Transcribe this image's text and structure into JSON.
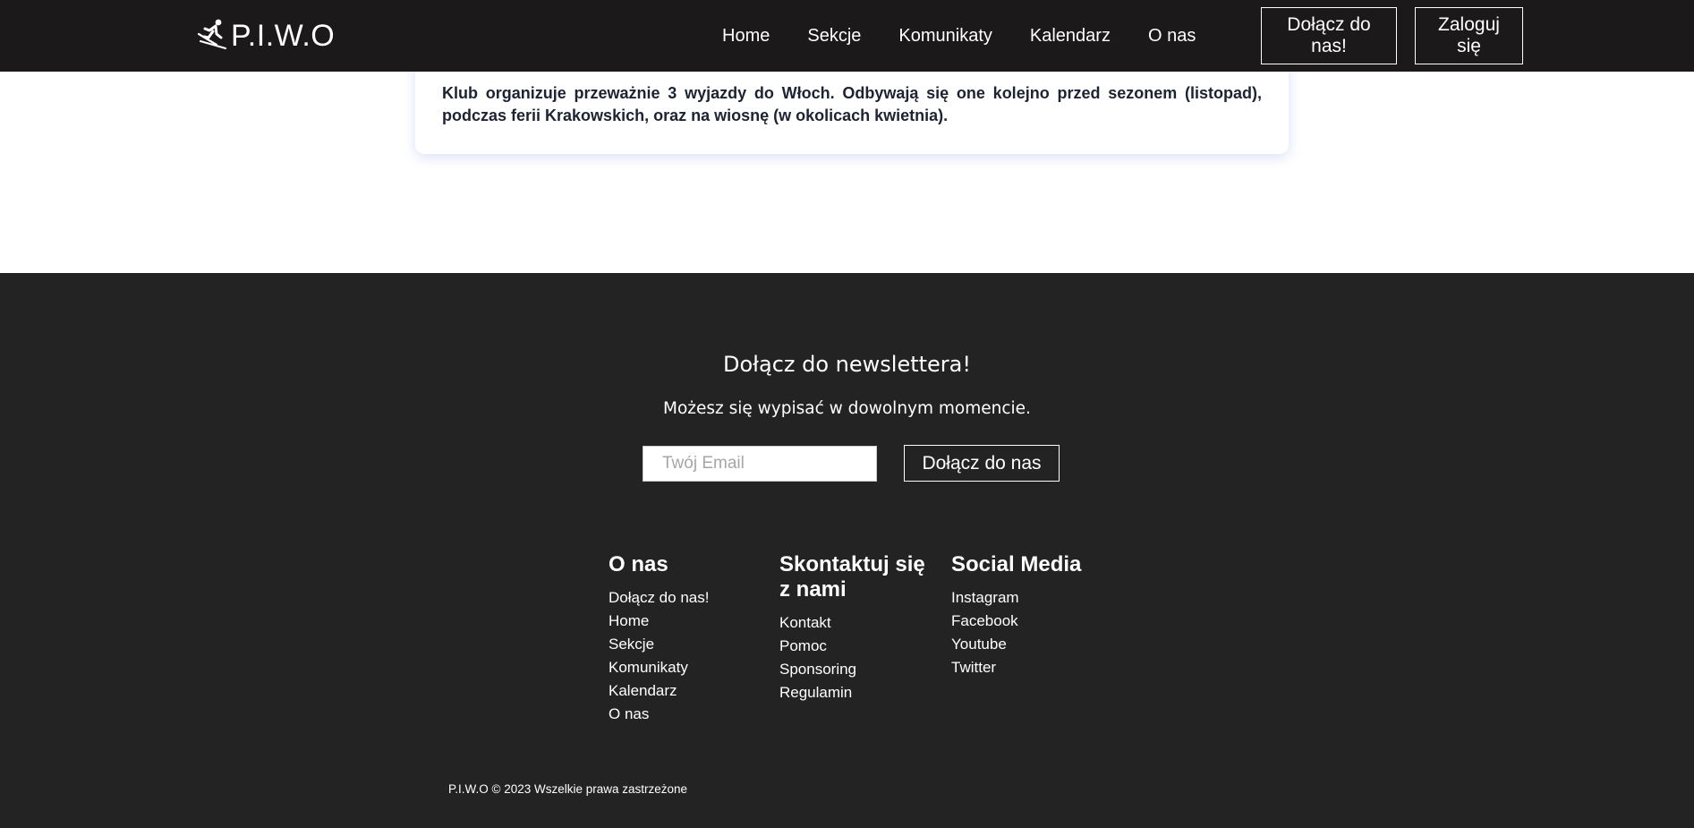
{
  "header": {
    "brand": "P.I.W.O",
    "nav": [
      "Home",
      "Sekcje",
      "Komunikaty",
      "Kalendarz",
      "O nas"
    ],
    "join_label": "Dołącz do nas!",
    "login_label": "Zaloguj się"
  },
  "content": {
    "text": "Klub organizuje przeważnie 3 wyjazdy do Włoch. Odbywają się one kolejno przed sezonem (listopad), podczas ferii Krakowskich, oraz na wiosnę (w okolicach kwietnia)."
  },
  "newsletter": {
    "title": "Dołącz do newslettera!",
    "subtitle": "Możesz się wypisać w dowolnym momencie.",
    "email_placeholder": "Twój Email",
    "button_label": "Dołącz do nas"
  },
  "footer": {
    "columns": [
      {
        "title": "O nas",
        "links": [
          "Dołącz do nas!",
          "Home",
          "Sekcje",
          "Komunikaty",
          "Kalendarz",
          "O nas"
        ]
      },
      {
        "title": "Skontaktuj się z nami",
        "links": [
          "Kontakt",
          "Pomoc",
          "Sponsoring",
          "Regulamin"
        ]
      },
      {
        "title": "Social Media",
        "links": [
          "Instagram",
          "Facebook",
          "Youtube",
          "Twitter"
        ]
      }
    ],
    "copyright": "P.I.W.O © 2023 Wszelkie prawa zastrzeżone"
  }
}
